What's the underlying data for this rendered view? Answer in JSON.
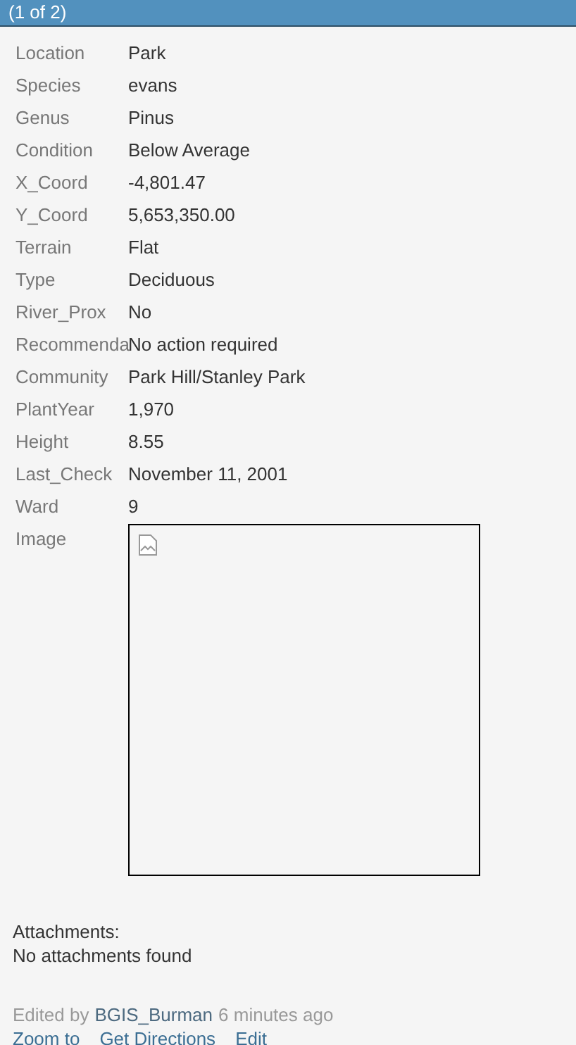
{
  "header": {
    "title": "(1 of 2)"
  },
  "fields": [
    {
      "label": "Location",
      "value": "Park"
    },
    {
      "label": "Species",
      "value": "evans"
    },
    {
      "label": "Genus",
      "value": "Pinus"
    },
    {
      "label": "Condition",
      "value": "Below Average"
    },
    {
      "label": "X_Coord",
      "value": "-4,801.47"
    },
    {
      "label": "Y_Coord",
      "value": "5,653,350.00"
    },
    {
      "label": "Terrain",
      "value": "Flat"
    },
    {
      "label": "Type",
      "value": "Deciduous"
    },
    {
      "label": "River_Prox",
      "value": "No"
    },
    {
      "label": "Recommenda",
      "value": "No action required"
    },
    {
      "label": "Community",
      "value": "Park Hill/Stanley Park"
    },
    {
      "label": "PlantYear",
      "value": "1,970"
    },
    {
      "label": "Height",
      "value": "8.55"
    },
    {
      "label": "Last_Check",
      "value": "November 11, 2001"
    },
    {
      "label": "Ward",
      "value": "9"
    },
    {
      "label": "Image",
      "kind": "image"
    }
  ],
  "attachments": {
    "title": "Attachments:",
    "message": "No attachments found"
  },
  "edited": {
    "prefix": "Edited by",
    "editor": "BGIS_Burman",
    "suffix": "6 minutes ago"
  },
  "actions": [
    "Zoom to",
    "Get Directions",
    "Edit"
  ]
}
